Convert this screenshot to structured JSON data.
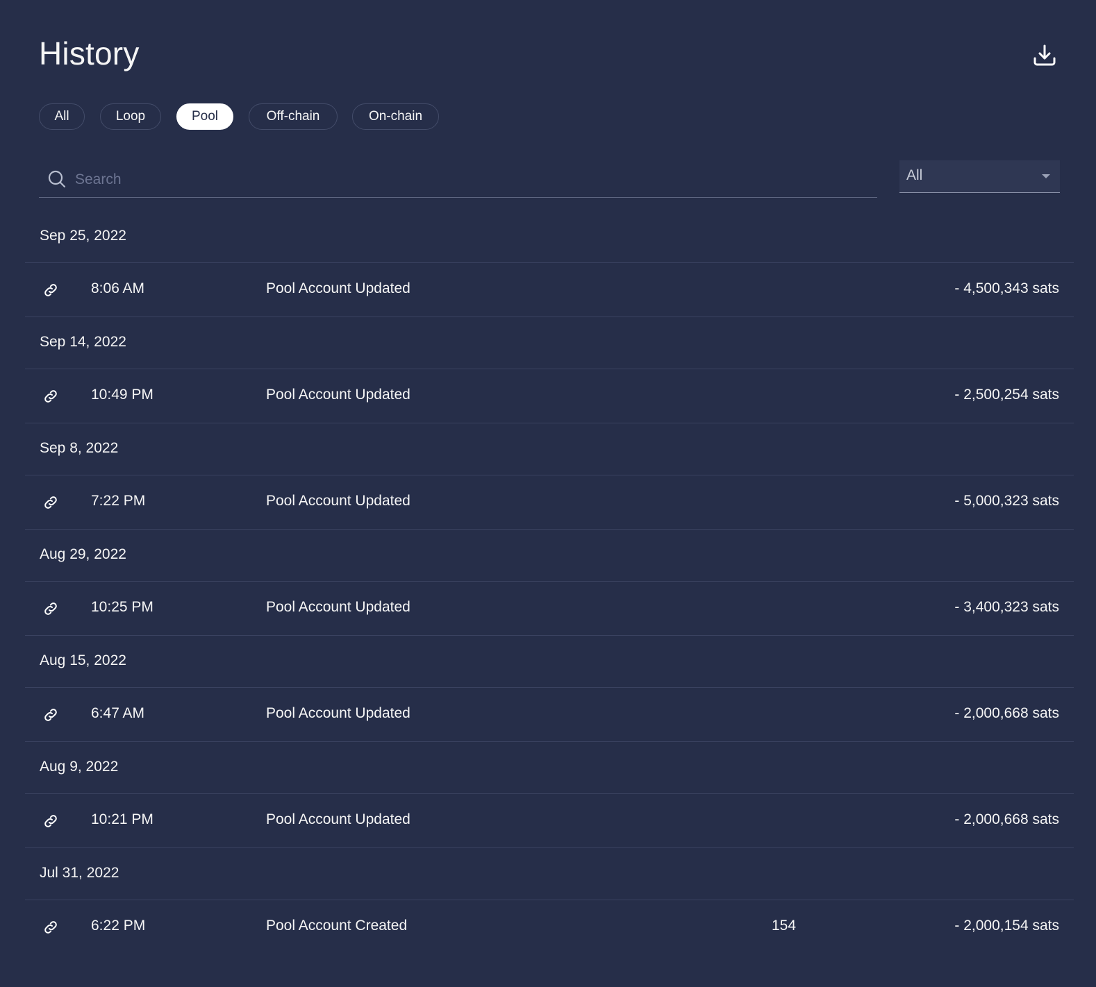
{
  "header": {
    "title": "History",
    "download_icon": "download-icon"
  },
  "filters": [
    {
      "label": "All",
      "active": false
    },
    {
      "label": "Loop",
      "active": false
    },
    {
      "label": "Pool",
      "active": true
    },
    {
      "label": "Off-chain",
      "active": false
    },
    {
      "label": "On-chain",
      "active": false
    }
  ],
  "search": {
    "placeholder": "Search",
    "value": ""
  },
  "type_select": {
    "value": "All"
  },
  "groups": [
    {
      "date": "Sep 25, 2022",
      "rows": [
        {
          "icon": "link-icon",
          "time": "8:06 AM",
          "description": "Pool Account Updated",
          "fee": "",
          "amount": "- 4,500,343 sats"
        }
      ]
    },
    {
      "date": "Sep 14, 2022",
      "rows": [
        {
          "icon": "link-icon",
          "time": "10:49 PM",
          "description": "Pool Account Updated",
          "fee": "",
          "amount": "- 2,500,254 sats"
        }
      ]
    },
    {
      "date": "Sep 8, 2022",
      "rows": [
        {
          "icon": "link-icon",
          "time": "7:22 PM",
          "description": "Pool Account Updated",
          "fee": "",
          "amount": "- 5,000,323 sats"
        }
      ]
    },
    {
      "date": "Aug 29, 2022",
      "rows": [
        {
          "icon": "link-icon",
          "time": "10:25 PM",
          "description": "Pool Account Updated",
          "fee": "",
          "amount": "- 3,400,323 sats"
        }
      ]
    },
    {
      "date": "Aug 15, 2022",
      "rows": [
        {
          "icon": "link-icon",
          "time": "6:47 AM",
          "description": "Pool Account Updated",
          "fee": "",
          "amount": "- 2,000,668 sats"
        }
      ]
    },
    {
      "date": "Aug 9, 2022",
      "rows": [
        {
          "icon": "link-icon",
          "time": "10:21 PM",
          "description": "Pool Account Updated",
          "fee": "",
          "amount": "- 2,000,668 sats"
        }
      ]
    },
    {
      "date": "Jul 31, 2022",
      "rows": [
        {
          "icon": "link-icon",
          "time": "6:22 PM",
          "description": "Pool Account Created",
          "fee": "154",
          "amount": "- 2,000,154 sats"
        }
      ]
    }
  ],
  "colors": {
    "background": "#262e49",
    "divider": "#3a4260",
    "text": "#f5f5f5",
    "active_pill_bg": "#ffffff",
    "active_pill_text": "#262e49"
  }
}
